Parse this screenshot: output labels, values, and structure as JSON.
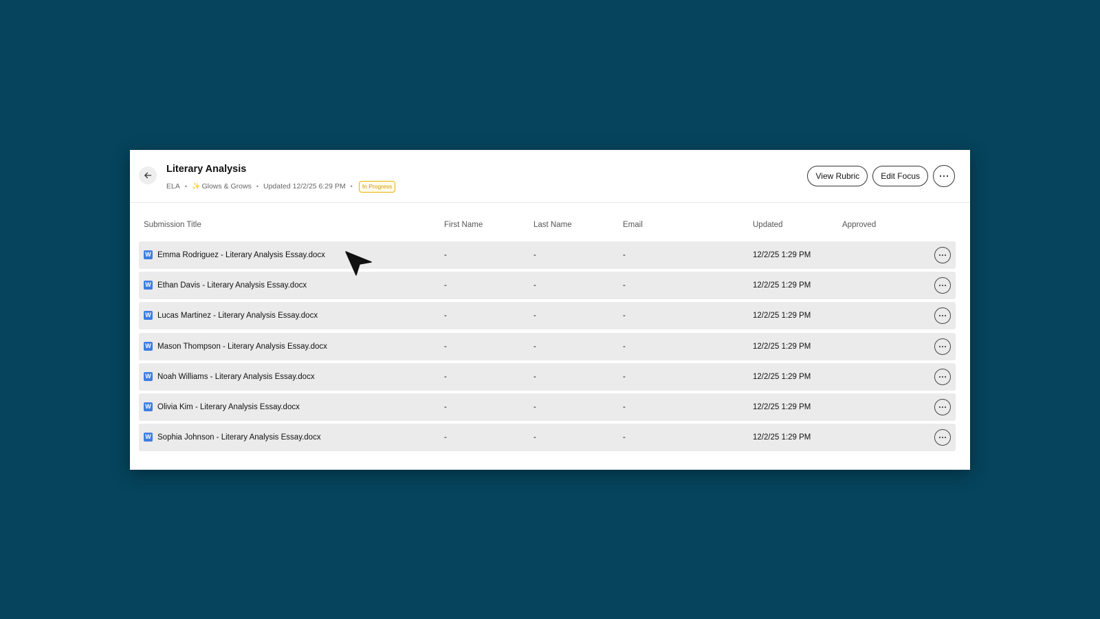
{
  "header": {
    "title": "Literary Analysis",
    "subject": "ELA",
    "focus": "Glows & Grows",
    "updated": "Updated 12/2/25 6:29 PM",
    "status": "In Progress",
    "status_color": "#e8b100",
    "view_rubric_label": "View Rubric",
    "edit_focus_label": "Edit Focus",
    "icons": [
      "arrow-left-icon",
      "sparkle-icon",
      "more-horizontal-icon"
    ]
  },
  "table": {
    "columns": {
      "title": "Submission Title",
      "first_name": "First Name",
      "last_name": "Last Name",
      "email": "Email",
      "updated": "Updated",
      "approved": "Approved"
    },
    "rows": [
      {
        "title": "Emma Rodriguez - Literary Analysis Essay.docx",
        "first_name": "-",
        "last_name": "-",
        "email": "-",
        "updated": "12/2/25 1:29 PM",
        "approved": ""
      },
      {
        "title": "Ethan Davis - Literary Analysis Essay.docx",
        "first_name": "-",
        "last_name": "-",
        "email": "-",
        "updated": "12/2/25 1:29 PM",
        "approved": ""
      },
      {
        "title": "Lucas Martinez - Literary Analysis Essay.docx",
        "first_name": "-",
        "last_name": "-",
        "email": "-",
        "updated": "12/2/25 1:29 PM",
        "approved": ""
      },
      {
        "title": "Mason Thompson - Literary Analysis Essay.docx",
        "first_name": "-",
        "last_name": "-",
        "email": "-",
        "updated": "12/2/25 1:29 PM",
        "approved": ""
      },
      {
        "title": "Noah Williams - Literary Analysis Essay.docx",
        "first_name": "-",
        "last_name": "-",
        "email": "-",
        "updated": "12/2/25 1:29 PM",
        "approved": ""
      },
      {
        "title": "Olivia Kim - Literary Analysis Essay.docx",
        "first_name": "-",
        "last_name": "-",
        "email": "-",
        "updated": "12/2/25 1:29 PM",
        "approved": ""
      },
      {
        "title": "Sophia Johnson - Literary Analysis Essay.docx",
        "first_name": "-",
        "last_name": "-",
        "email": "-",
        "updated": "12/2/25 1:29 PM",
        "approved": ""
      }
    ],
    "file_icon": "word-document-icon",
    "file_icon_letter": "W",
    "file_icon_color": "#3f7de0"
  },
  "colors": {
    "background": "#05445c",
    "row_background": "#ebebeb"
  }
}
